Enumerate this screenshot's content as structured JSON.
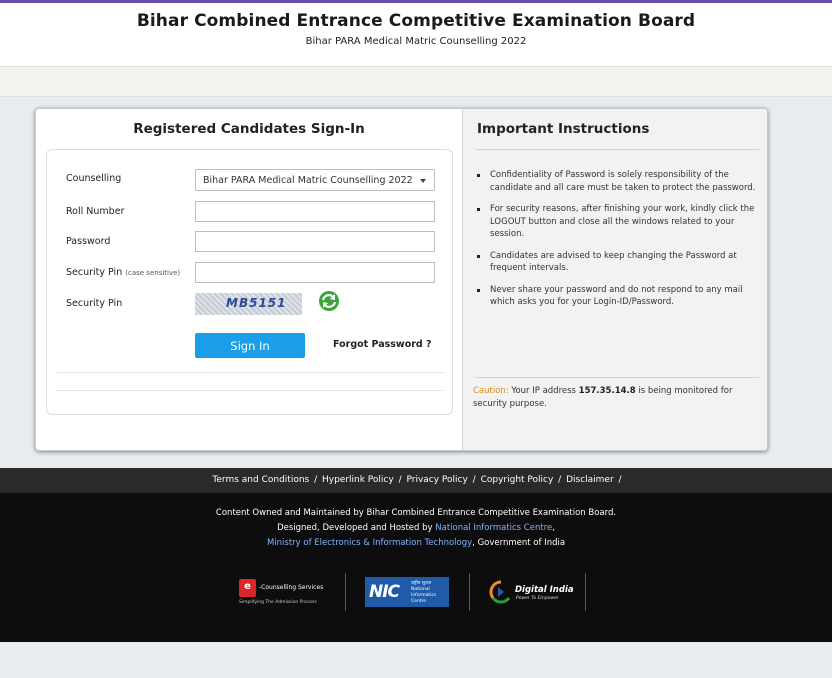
{
  "header": {
    "title": "Bihar Combined Entrance Competitive Examination Board",
    "subtitle": "Bihar PARA Medical Matric Counselling 2022"
  },
  "signin": {
    "title": "Registered Candidates Sign-In",
    "counselling_label": "Counselling",
    "counselling_value": "Bihar PARA Medical Matric Counselling 2022",
    "roll_label": "Roll Number",
    "password_label": "Password",
    "pin_label": "Security Pin",
    "pin_hint": "(case sensitive)",
    "captcha_label": "Security Pin",
    "captcha_text": "MB5151",
    "signin_button": "Sign In",
    "forgot_link": "Forgot Password ?"
  },
  "instructions": {
    "title": "Important Instructions",
    "items": [
      "Confidentiality of Password is solely responsibility of the candidate and all care must be taken to protect the password.",
      "For security reasons, after finishing your work, kindly click the LOGOUT button and close all the windows related to your session.",
      "Candidates are advised to keep changing the Password at frequent intervals.",
      "Never share your password and do not respond to any mail which asks you for your Login-ID/Password."
    ],
    "caution_label": "Caution:",
    "caution_pre": "Your IP address",
    "caution_ip": "157.35.14.8",
    "caution_post": "is being monitored for security purpose."
  },
  "footer_links": [
    "Terms and Conditions",
    "Hyperlink Policy",
    "Privacy Policy",
    "Copyright Policy",
    "Disclaimer"
  ],
  "footer": {
    "line1": "Content Owned and Maintained by Bihar Combined Entrance Competitive Examination Board.",
    "line2_pre": "Designed, Developed and Hosted by",
    "line2_link": "National Informatics Centre",
    "line2_post": ",",
    "line3_link": "Ministry of Electronics & Information Technology",
    "line3_post": ", Government of India",
    "logo_ec_title": "-Counselling Services",
    "logo_ec_tagline": "Simplifying The Admission Process",
    "logo_nic_text": "NIC",
    "logo_nic_sub_hi": "राष्ट्रीय सूचना",
    "logo_nic_sub1": "National",
    "logo_nic_sub2": "Informatics",
    "logo_nic_sub3": "Centre",
    "logo_di_title": "Digital India",
    "logo_di_tagline": "Power To Empower"
  },
  "colors": {
    "accent_button": "#1a9ee8",
    "caution": "#e38a1b",
    "footer_bg": "#0d0d0d",
    "link": "#7fb2ff"
  }
}
